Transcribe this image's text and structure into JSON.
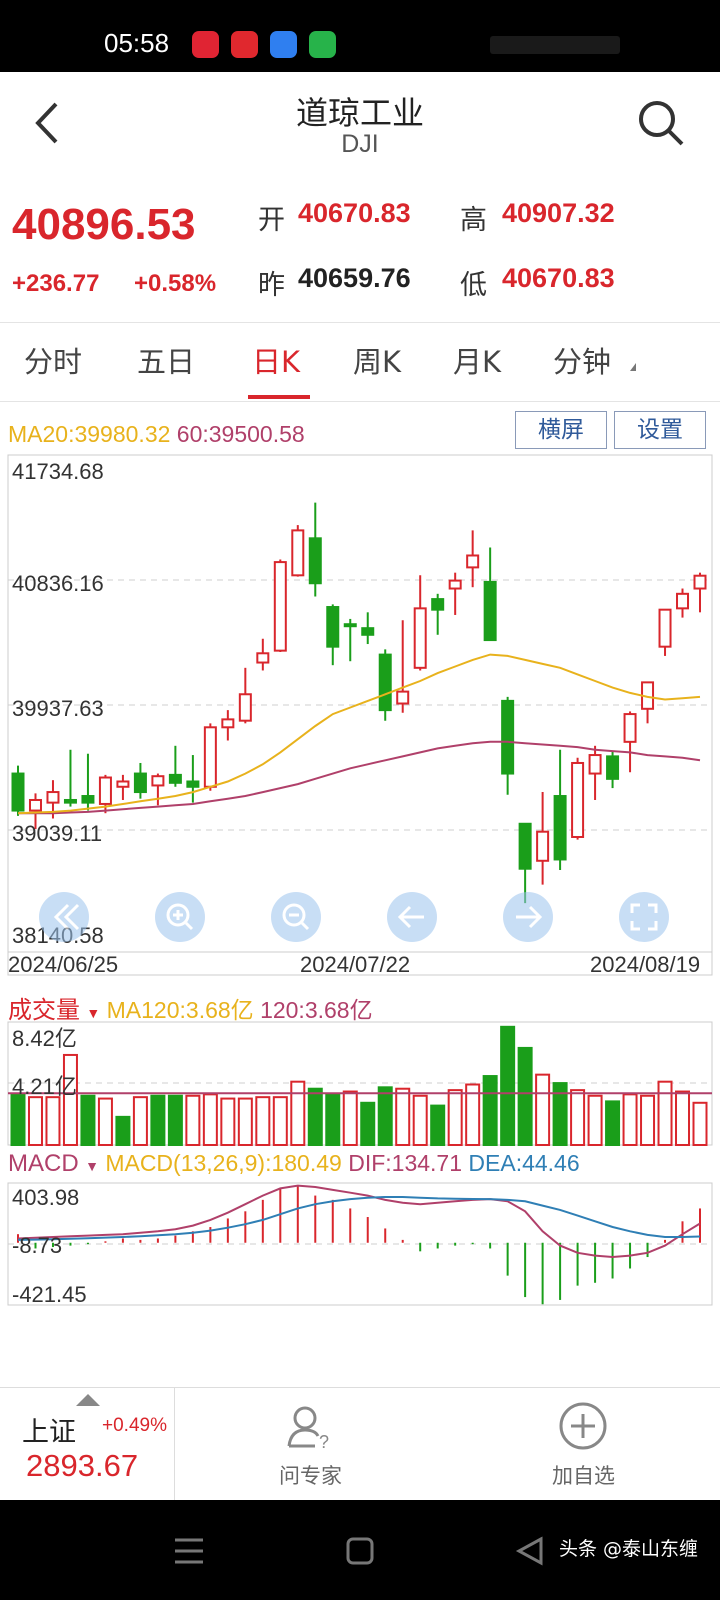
{
  "status": {
    "time": "05:58"
  },
  "header": {
    "title": "道琼工业",
    "subtitle": "DJI"
  },
  "quote": {
    "price": "40896.53",
    "change": "+236.77",
    "change_pct": "+0.58%",
    "open_label": "开",
    "open": "40670.83",
    "high_label": "高",
    "high": "40907.32",
    "prev_label": "昨",
    "prev": "40659.76",
    "low_label": "低",
    "low": "40670.83"
  },
  "tabs": [
    {
      "label": "分时"
    },
    {
      "label": "五日"
    },
    {
      "label": "日K"
    },
    {
      "label": "周K"
    },
    {
      "label": "月K"
    },
    {
      "label": "分钟"
    }
  ],
  "buttons": {
    "landscape": "横屏",
    "settings": "设置"
  },
  "legend_main": {
    "ma20": "MA20:39980.32",
    "ma60": "60:39500.58"
  },
  "legend_volume": {
    "title": "成交量",
    "ma120": "MA120:3.68亿",
    "v120": "120:3.68亿"
  },
  "legend_macd": {
    "title": "MACD",
    "params": "MACD(13,26,9):180.49",
    "dif": "DIF:134.71",
    "dea": "DEA:44.46"
  },
  "colors": {
    "up": "#d9262c",
    "down": "#1a9e1a",
    "ma20": "#e8b21c",
    "ma60": "#b0406a",
    "dea": "#2f7fb5"
  },
  "chart_data": {
    "type": "candlestick",
    "price_axis": {
      "ticks": [
        "41734.68",
        "40836.16",
        "39937.63",
        "39039.11",
        "38140.58"
      ],
      "ylim": [
        38140.58,
        41734.68
      ]
    },
    "date_labels": [
      "2024/06/25",
      "2024/07/22",
      "2024/08/19"
    ],
    "candles": [
      {
        "o": 39400,
        "h": 39460,
        "l": 39080,
        "c": 39120
      },
      {
        "o": 39120,
        "h": 39250,
        "l": 38980,
        "c": 39200
      },
      {
        "o": 39180,
        "h": 39350,
        "l": 39060,
        "c": 39260
      },
      {
        "o": 39200,
        "h": 39580,
        "l": 39150,
        "c": 39180
      },
      {
        "o": 39230,
        "h": 39550,
        "l": 39120,
        "c": 39180
      },
      {
        "o": 39170,
        "h": 39390,
        "l": 39100,
        "c": 39370
      },
      {
        "o": 39300,
        "h": 39390,
        "l": 39200,
        "c": 39340
      },
      {
        "o": 39400,
        "h": 39480,
        "l": 39210,
        "c": 39260
      },
      {
        "o": 39310,
        "h": 39400,
        "l": 39160,
        "c": 39380
      },
      {
        "o": 39390,
        "h": 39610,
        "l": 39300,
        "c": 39330
      },
      {
        "o": 39340,
        "h": 39540,
        "l": 39180,
        "c": 39300
      },
      {
        "o": 39300,
        "h": 39780,
        "l": 39270,
        "c": 39750
      },
      {
        "o": 39750,
        "h": 39880,
        "l": 39650,
        "c": 39810
      },
      {
        "o": 39800,
        "h": 40200,
        "l": 39780,
        "c": 40000
      },
      {
        "o": 40240,
        "h": 40420,
        "l": 40180,
        "c": 40310
      },
      {
        "o": 40330,
        "h": 41020,
        "l": 40320,
        "c": 41000
      },
      {
        "o": 40900,
        "h": 41280,
        "l": 40890,
        "c": 41240
      },
      {
        "o": 41180,
        "h": 41450,
        "l": 40740,
        "c": 40840
      },
      {
        "o": 40660,
        "h": 40680,
        "l": 40220,
        "c": 40360
      },
      {
        "o": 40530,
        "h": 40570,
        "l": 40250,
        "c": 40520
      },
      {
        "o": 40500,
        "h": 40620,
        "l": 40380,
        "c": 40450
      },
      {
        "o": 40300,
        "h": 40340,
        "l": 39800,
        "c": 39880
      },
      {
        "o": 39930,
        "h": 40560,
        "l": 39860,
        "c": 40020
      },
      {
        "o": 40200,
        "h": 40900,
        "l": 40180,
        "c": 40650
      },
      {
        "o": 40720,
        "h": 40760,
        "l": 40450,
        "c": 40640
      },
      {
        "o": 40800,
        "h": 40920,
        "l": 40600,
        "c": 40860
      },
      {
        "o": 40960,
        "h": 41240,
        "l": 40810,
        "c": 41050
      },
      {
        "o": 40850,
        "h": 41110,
        "l": 40430,
        "c": 40410
      },
      {
        "o": 39950,
        "h": 39980,
        "l": 39240,
        "c": 39400
      },
      {
        "o": 39020,
        "h": 39020,
        "l": 38420,
        "c": 38680
      },
      {
        "o": 38740,
        "h": 39260,
        "l": 38560,
        "c": 38960
      },
      {
        "o": 39230,
        "h": 39580,
        "l": 38670,
        "c": 38750
      },
      {
        "o": 38920,
        "h": 39520,
        "l": 38900,
        "c": 39480
      },
      {
        "o": 39400,
        "h": 39610,
        "l": 39200,
        "c": 39540
      },
      {
        "o": 39530,
        "h": 39570,
        "l": 39290,
        "c": 39360
      },
      {
        "o": 39640,
        "h": 39870,
        "l": 39410,
        "c": 39850
      },
      {
        "o": 39890,
        "h": 40060,
        "l": 39780,
        "c": 40090
      },
      {
        "o": 40360,
        "h": 40620,
        "l": 40290,
        "c": 40640
      },
      {
        "o": 40650,
        "h": 40800,
        "l": 40580,
        "c": 40760
      },
      {
        "o": 40800,
        "h": 40920,
        "l": 40620,
        "c": 40897
      }
    ],
    "ma20": [
      39100,
      39105,
      39110,
      39120,
      39135,
      39150,
      39170,
      39190,
      39210,
      39230,
      39260,
      39300,
      39340,
      39400,
      39470,
      39560,
      39660,
      39760,
      39850,
      39900,
      39950,
      40000,
      40050,
      40100,
      40160,
      40210,
      40260,
      40300,
      40290,
      40260,
      40230,
      40200,
      40150,
      40100,
      40050,
      40010,
      39980,
      39960,
      39970,
      39980
    ],
    "ma60": [
      39100,
      39100,
      39100,
      39105,
      39110,
      39120,
      39130,
      39140,
      39150,
      39160,
      39170,
      39190,
      39210,
      39230,
      39260,
      39290,
      39320,
      39360,
      39400,
      39440,
      39470,
      39500,
      39530,
      39560,
      39590,
      39610,
      39630,
      39640,
      39640,
      39630,
      39620,
      39610,
      39600,
      39580,
      39570,
      39560,
      39540,
      39530,
      39520,
      39500
    ],
    "volume": {
      "ticks": [
        "8.42亿",
        "4.21亿"
      ],
      "bars": [
        {
          "v": 3.6,
          "up": false
        },
        {
          "v": 3.4,
          "up": true
        },
        {
          "v": 3.4,
          "up": true
        },
        {
          "v": 6.4,
          "up": true
        },
        {
          "v": 3.5,
          "up": false
        },
        {
          "v": 3.3,
          "up": true
        },
        {
          "v": 2.0,
          "up": false
        },
        {
          "v": 3.4,
          "up": true
        },
        {
          "v": 3.5,
          "up": false
        },
        {
          "v": 3.5,
          "up": false
        },
        {
          "v": 3.5,
          "up": true
        },
        {
          "v": 3.6,
          "up": true
        },
        {
          "v": 3.3,
          "up": true
        },
        {
          "v": 3.3,
          "up": true
        },
        {
          "v": 3.4,
          "up": true
        },
        {
          "v": 3.4,
          "up": true
        },
        {
          "v": 4.5,
          "up": true
        },
        {
          "v": 4.0,
          "up": false
        },
        {
          "v": 3.6,
          "up": false
        },
        {
          "v": 3.8,
          "up": true
        },
        {
          "v": 3.0,
          "up": false
        },
        {
          "v": 4.1,
          "up": false
        },
        {
          "v": 4.0,
          "up": true
        },
        {
          "v": 3.5,
          "up": true
        },
        {
          "v": 2.8,
          "up": false
        },
        {
          "v": 3.9,
          "up": true
        },
        {
          "v": 4.3,
          "up": true
        },
        {
          "v": 4.9,
          "up": false
        },
        {
          "v": 8.4,
          "up": false
        },
        {
          "v": 6.9,
          "up": false
        },
        {
          "v": 5.0,
          "up": true
        },
        {
          "v": 4.4,
          "up": false
        },
        {
          "v": 3.9,
          "up": true
        },
        {
          "v": 3.5,
          "up": true
        },
        {
          "v": 3.1,
          "up": false
        },
        {
          "v": 3.6,
          "up": true
        },
        {
          "v": 3.5,
          "up": true
        },
        {
          "v": 4.5,
          "up": true
        },
        {
          "v": 3.8,
          "up": true
        },
        {
          "v": 3.0,
          "up": true
        }
      ],
      "ma120": 3.68
    },
    "macd": {
      "ticks": [
        "403.98",
        "-8.73",
        "-421.45"
      ],
      "ylim": [
        -421.45,
        403.98
      ],
      "hist": [
        60,
        -40,
        -30,
        -20,
        -10,
        10,
        30,
        20,
        30,
        50,
        80,
        110,
        170,
        220,
        300,
        380,
        400,
        330,
        300,
        240,
        180,
        100,
        20,
        -60,
        -40,
        -20,
        -10,
        -40,
        -230,
        -380,
        -430,
        -400,
        -300,
        -280,
        -250,
        -180,
        -100,
        20,
        150,
        240
      ],
      "dif": [
        30,
        35,
        40,
        45,
        50,
        55,
        60,
        70,
        80,
        95,
        120,
        160,
        210,
        270,
        330,
        380,
        400,
        390,
        370,
        350,
        330,
        300,
        280,
        270,
        280,
        290,
        300,
        305,
        290,
        220,
        80,
        -20,
        -70,
        -90,
        -100,
        -90,
        -70,
        -20,
        60,
        135
      ],
      "dea": [
        20,
        22,
        25,
        28,
        32,
        36,
        40,
        46,
        52,
        60,
        70,
        85,
        105,
        130,
        160,
        200,
        240,
        270,
        290,
        305,
        315,
        320,
        320,
        315,
        310,
        308,
        306,
        305,
        300,
        290,
        260,
        230,
        190,
        150,
        110,
        80,
        55,
        40,
        40,
        44
      ]
    }
  },
  "bottom": {
    "index_name": "上证",
    "index_pct": "+0.49%",
    "index_value": "2893.67",
    "expert_label": "问专家",
    "add_label": "加自选"
  },
  "watermark": "头条 @泰山东缠"
}
